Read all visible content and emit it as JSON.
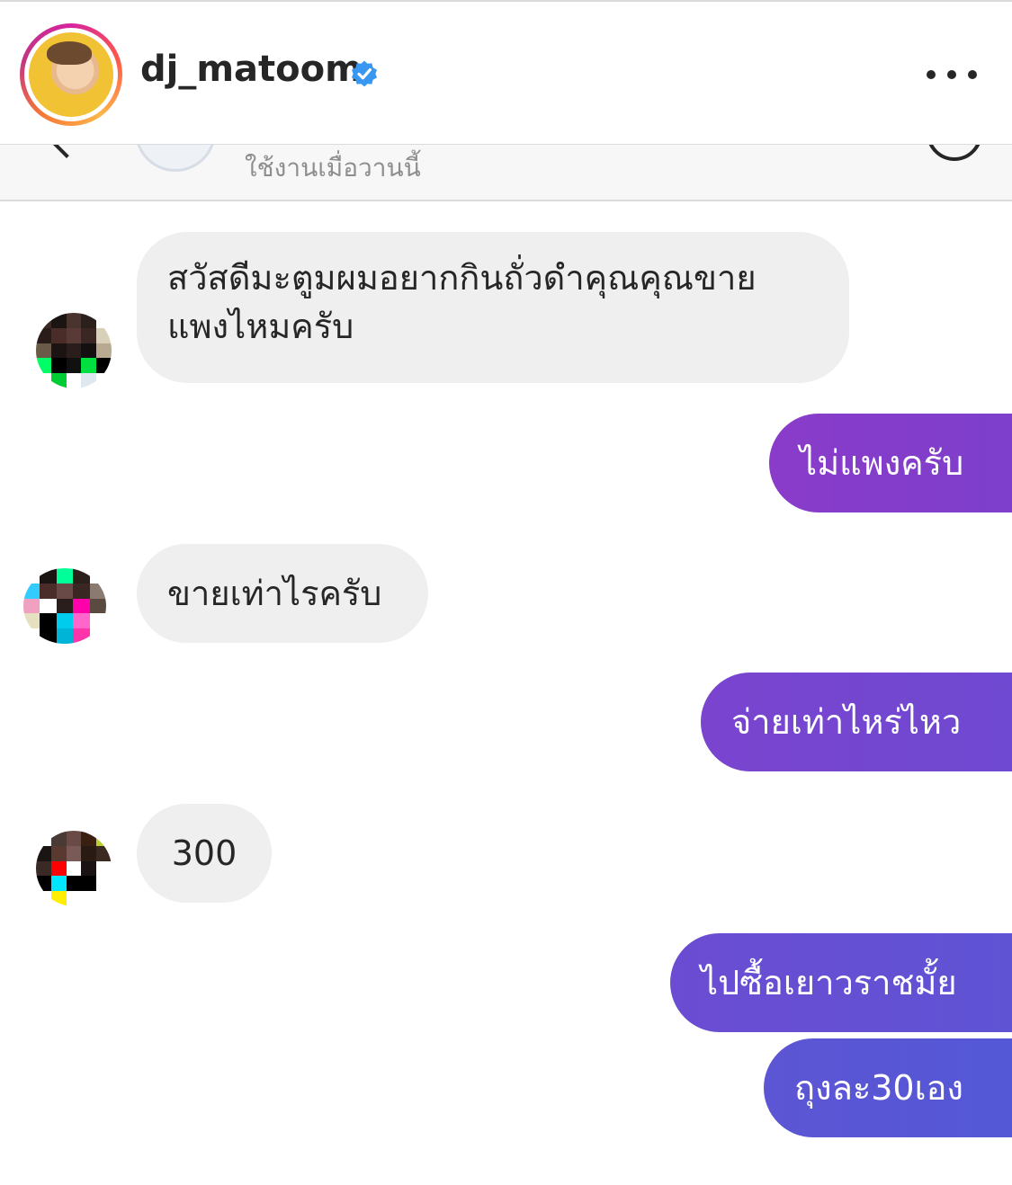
{
  "header": {
    "username": "dj_matoom"
  },
  "chat": {
    "status": "ใช้งานเมื่อวานนี้"
  },
  "messages": [
    {
      "sender": "contact",
      "text": "สวัสดีมะตูมผมอยากกินถั่วดำคุณคุณขาย แพงไหมครับ"
    },
    {
      "sender": "me",
      "text": "ไม่แพงครับ"
    },
    {
      "sender": "contact",
      "text": "ขายเท่าไรครับ"
    },
    {
      "sender": "me",
      "text": "จ่ายเท่าไหร่ไหว"
    },
    {
      "sender": "contact",
      "text": "300"
    },
    {
      "sender": "me",
      "text": "ไปซื้อเยาวราชมั้ย"
    },
    {
      "sender": "me",
      "text": "ถุงละ30เอง"
    }
  ],
  "colors": {
    "incoming_bubble": "#efefef",
    "outgoing_gradient": [
      "#8a3ac9",
      "#5d59d6"
    ],
    "verified": "#3897f0"
  }
}
